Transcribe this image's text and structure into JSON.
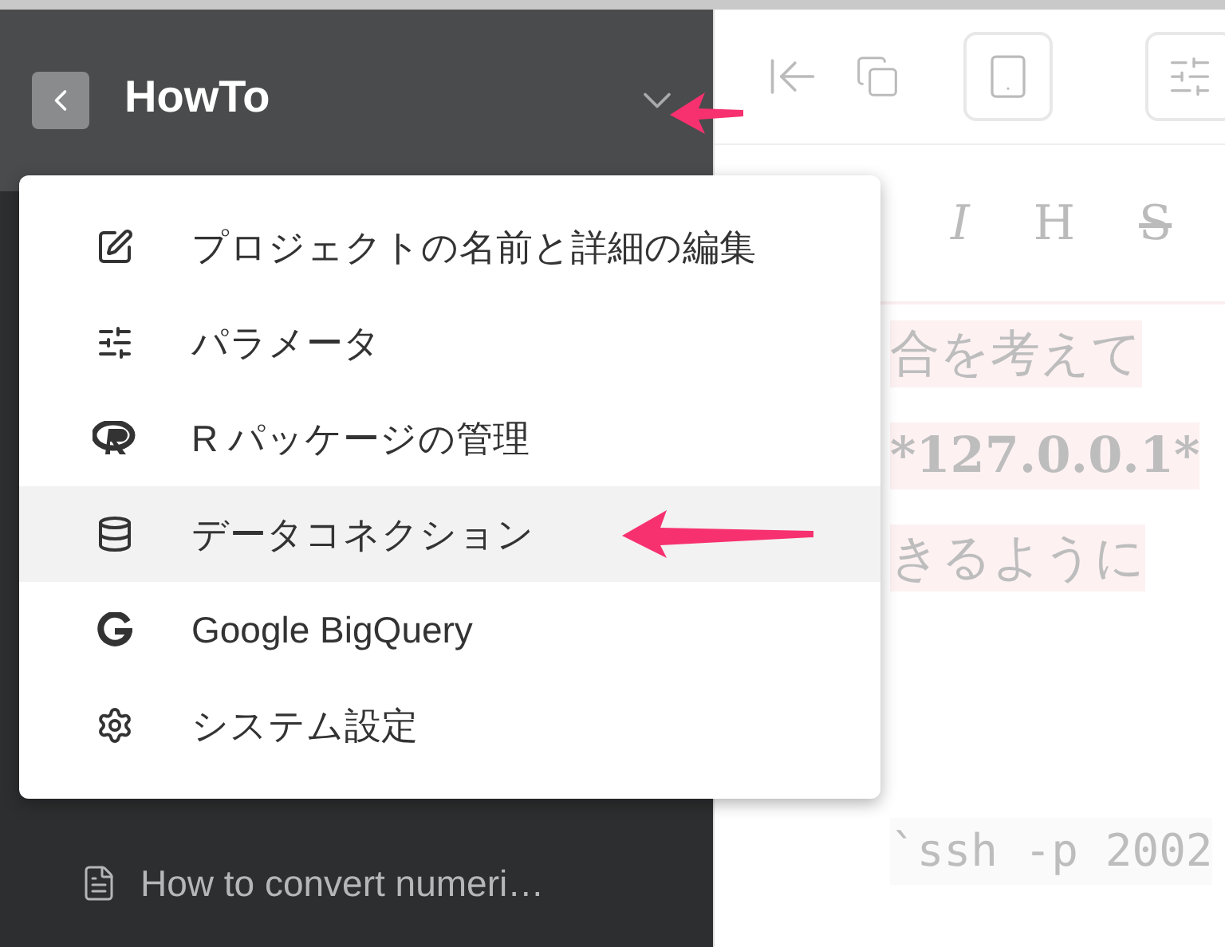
{
  "sidebar": {
    "project_title": "HowTo",
    "items": [
      {
        "label": "How to convert numeri…"
      }
    ]
  },
  "project_menu": {
    "items": [
      {
        "kind": "edit",
        "label": "プロジェクトの名前と詳細の編集",
        "selected": false
      },
      {
        "kind": "sliders",
        "label": "パラメータ",
        "selected": false
      },
      {
        "kind": "r",
        "label": "R パッケージの管理",
        "selected": false
      },
      {
        "kind": "database",
        "label": "データコネクション",
        "selected": true
      },
      {
        "kind": "google",
        "label": "Google BigQuery",
        "selected": false
      },
      {
        "kind": "gear",
        "label": "システム設定",
        "selected": false
      }
    ]
  },
  "editor": {
    "format_buttons": [
      {
        "kind": "italic",
        "label": "I"
      },
      {
        "kind": "heading",
        "label": "H"
      },
      {
        "kind": "strike",
        "label": "S"
      }
    ],
    "lines": [
      {
        "kind": "text",
        "text": "合を考えて"
      },
      {
        "kind": "bold",
        "text": "*127.0.0.1*"
      },
      {
        "kind": "text",
        "text": "きるように"
      },
      {
        "kind": "code",
        "text": "`ssh -p 2002"
      }
    ]
  }
}
